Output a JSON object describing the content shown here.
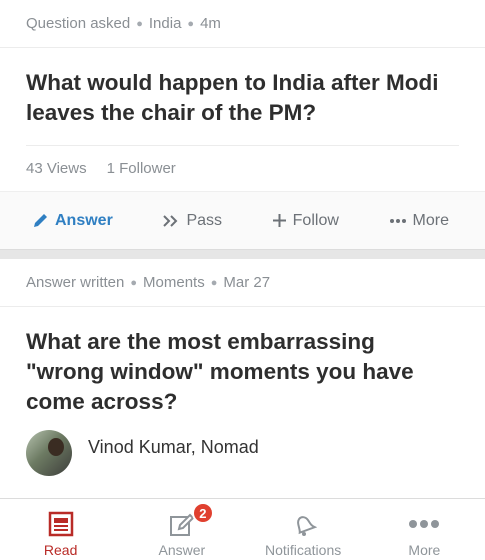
{
  "feed": {
    "item1": {
      "meta": {
        "kind": "Question asked",
        "topic": "India",
        "age": "4m"
      },
      "title": "What would happen to India after Modi leaves the chair of the PM?",
      "views": "43 Views",
      "followers": "1 Follower",
      "actions": {
        "answer": "Answer",
        "pass": "Pass",
        "follow": "Follow",
        "more": "More"
      }
    },
    "item2": {
      "meta": {
        "kind": "Answer written",
        "topic": "Moments",
        "age": "Mar 27"
      },
      "title": "What are the most embarrassing \"wrong window\" moments you have come across?",
      "author": "Vinod Kumar, Nomad"
    }
  },
  "tabbar": {
    "read": "Read",
    "answer": "Answer",
    "answer_badge": "2",
    "notifications": "Notifications",
    "more": "More"
  },
  "colors": {
    "accent": "#b92b27",
    "link": "#2f7fc2",
    "badge": "#e0402f"
  }
}
